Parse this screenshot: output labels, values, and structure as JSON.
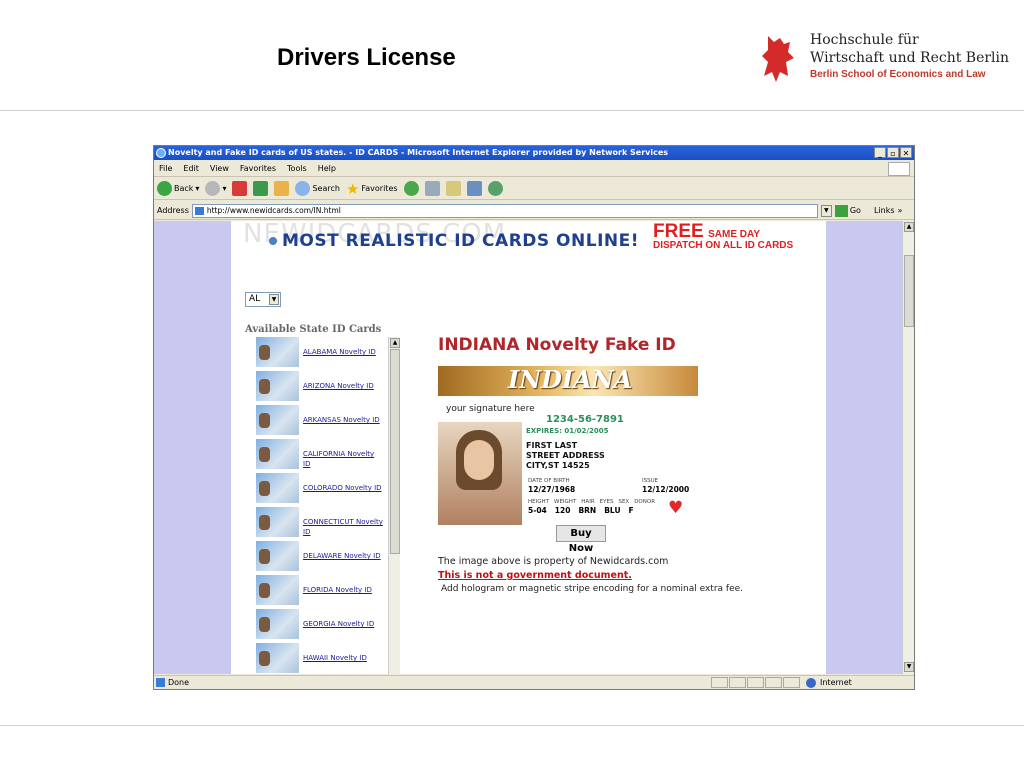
{
  "slide": {
    "title": "Drivers License",
    "logo_line1": "Hochschule für",
    "logo_line2": "Wirtschaft und Recht Berlin",
    "logo_line3": "Berlin School of Economics and Law"
  },
  "browser": {
    "window_title": "Novelty and Fake ID cards of US states. - ID CARDS - Microsoft Internet Explorer provided by Network Services",
    "menu": [
      "File",
      "Edit",
      "View",
      "Favorites",
      "Tools",
      "Help"
    ],
    "toolbar": {
      "back": "Back",
      "search": "Search",
      "favorites": "Favorites"
    },
    "address_label": "Address",
    "url": "http://www.newidcards.com/IN.html",
    "go": "Go",
    "links": "Links",
    "status": "Done",
    "zone": "Internet"
  },
  "page": {
    "watermark": "NEWIDCARDS.COM",
    "banner": "MOST REALISTIC ID CARDS ONLINE!",
    "free_big": "FREE",
    "free_small": "SAME DAY",
    "free_line2": "DISPATCH ON ALL ID CARDS",
    "state_select": "AL",
    "available_heading": "Available State ID Cards",
    "states": [
      "ALABAMA Novelty ID",
      "ARIZONA Novelty ID",
      "ARKANSAS Novelty ID",
      "CALIFORNIA Novelty ID",
      "COLORADO Novelty ID",
      "CONNECTICUT Novelty ID",
      "DELAWARE Novelty ID",
      "FLORIDA Novelty ID",
      "GEORGIA Novelty ID",
      "HAWAII Novelty ID"
    ],
    "id_title": "INDIANA Novelty Fake ID",
    "card": {
      "state": "INDIANA",
      "signature": "your signature here",
      "number": "1234-56-7891",
      "expires": "EXPIRES: 01/02/2005",
      "name": "FIRST LAST",
      "street": "STREET ADDRESS",
      "city": "CITY,ST  14525",
      "dob_label": "DATE OF BIRTH",
      "dob": "12/27/1968",
      "issue_label": "ISSUE",
      "issue": "12/12/2000",
      "stat_labels": [
        "HEIGHT",
        "WEIGHT",
        "HAIR",
        "EYES",
        "SEX",
        "DONOR"
      ],
      "stat_values": [
        "5-04",
        "120",
        "BRN",
        "BLU",
        "F"
      ]
    },
    "buy_now": "Buy Now",
    "property_note": "The image above is property of Newidcards.com",
    "not_gov": "This is not a government document.",
    "hologram_note": "Add hologram or magnetic stripe encoding for a nominal extra fee."
  }
}
